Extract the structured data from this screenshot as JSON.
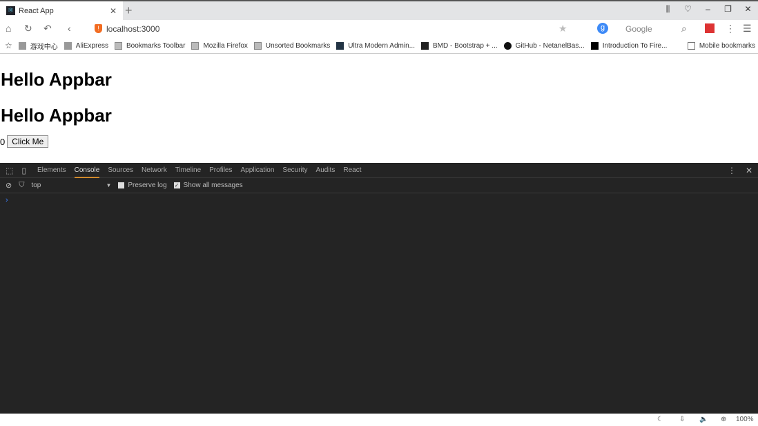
{
  "browser": {
    "tab_title": "React App",
    "url": "localhost:3000",
    "search_engine": "Google",
    "zoom": "100%"
  },
  "bookmarks": [
    "游戏中心",
    "AliExpress",
    "Bookmarks Toolbar",
    "Mozilla Firefox",
    "Unsorted Bookmarks",
    "Ultra Modern Admin...",
    "BMD - Bootstrap + ...",
    "GitHub - NetanelBas...",
    "Introduction To Fire..."
  ],
  "mobile_bookmarks": "Mobile bookmarks",
  "page": {
    "heading1": "Hello Appbar",
    "heading2": "Hello Appbar",
    "count": "0",
    "button": "Click Me"
  },
  "devtools": {
    "tabs": [
      "Elements",
      "Console",
      "Sources",
      "Network",
      "Timeline",
      "Profiles",
      "Application",
      "Security",
      "Audits",
      "React"
    ],
    "active_tab": "Console",
    "context": "top",
    "preserve_log": "Preserve log",
    "show_all": "Show all messages",
    "prompt": "›"
  }
}
